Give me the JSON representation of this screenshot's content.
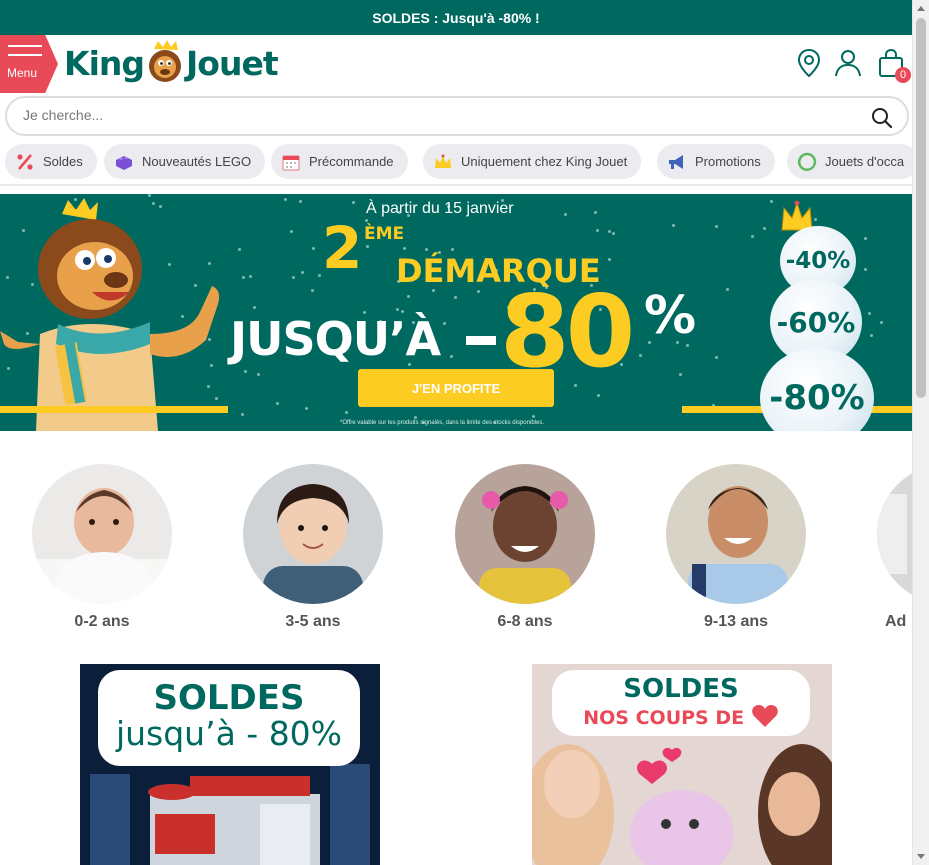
{
  "topbar": {
    "text": "SOLDES : Jusqu'à -80% !"
  },
  "header": {
    "menu_label": "Menu",
    "logo_left": "King",
    "logo_right": "Jouet",
    "cart_count": "0"
  },
  "search": {
    "placeholder": "Je cherche..."
  },
  "categories": [
    {
      "label": "Soldes",
      "icon": "percent-icon"
    },
    {
      "label": "Nouveautés LEGO",
      "icon": "lego-brick-icon"
    },
    {
      "label": "Précommande",
      "icon": "calendar-icon"
    },
    {
      "label": "Uniquement chez King Jouet",
      "icon": "crown-icon"
    },
    {
      "label": "Promotions",
      "icon": "megaphone-icon"
    },
    {
      "label": "Jouets d'occa",
      "icon": "recycle-icon"
    }
  ],
  "banner": {
    "date": "À partir du 15 janvier",
    "number": "2",
    "ordinal": "ÈME",
    "title": "DÉMARQUE",
    "jusqu": "JUSQU’À",
    "percent_value": "80",
    "percent_sign": "%",
    "cta": "J'EN PROFITE",
    "note": "*Offre valable sur les produits signalés, dans la limite des stocks disponibles.",
    "discounts": [
      "-40%",
      "-60%",
      "-80%"
    ]
  },
  "age_groups": [
    {
      "label": "0-2 ans"
    },
    {
      "label": "3-5 ans"
    },
    {
      "label": "6-8 ans"
    },
    {
      "label": "9-13 ans"
    },
    {
      "label": "Ad"
    }
  ],
  "promos": [
    {
      "line1": "SOLDES",
      "line2": "jusqu’à - 80%"
    },
    {
      "line1": "SOLDES",
      "line2": "NOS COUPS DE"
    }
  ],
  "colors": {
    "brand_green": "#00695f",
    "accent_red": "#e94a57",
    "yellow": "#fccc22"
  }
}
